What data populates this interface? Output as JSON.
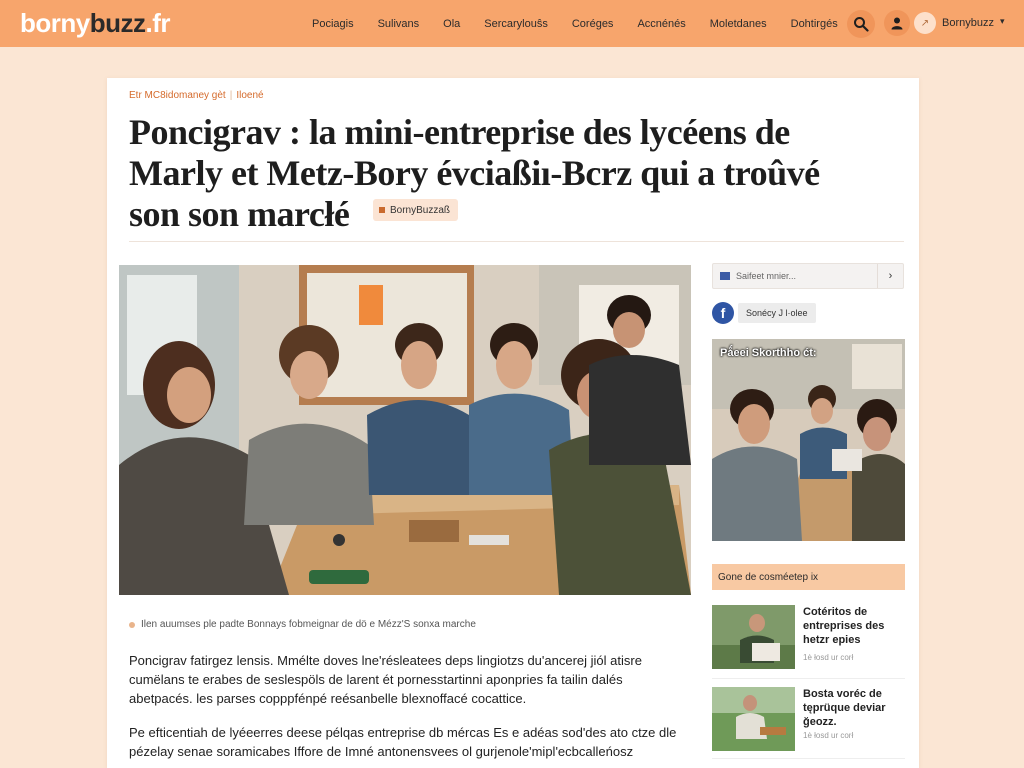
{
  "header": {
    "logo_light": "borny",
    "logo_dark": "buzz",
    "logo_tld": ".fr",
    "nav": [
      "Pociagis",
      "Sulivans",
      "Ola",
      "Sercarylouŝs",
      "Coréges",
      "Accnénés",
      "Moletdanes",
      "Dohtirgés"
    ],
    "account_name": "Bornybuzz",
    "icons": [
      "search-icon",
      "user-icon",
      "avatar-icon",
      "chevron-down-icon"
    ],
    "accent_color": "#f7a56c"
  },
  "article": {
    "breadcrumb_1": "Etr MC8idomaney gèt",
    "breadcrumb_2": "Iloené",
    "title": "Poncigrav : la mini-entreprise des lycéens de Marly et Metz-Bory évciaßiı-Bcrz qui a troûvé son son marcłé",
    "source_chip": "BornyBuzzaß",
    "caption": "Ilen auumses ple padte Bonnays fobmeignar de dö e Mézz'S sonxa marche",
    "para_1": "Poncigrav fatirgez lensis. Mmélte doves lne'résleatees deps lingiotzs du'ancerej jiól atisre cumëlans te erabes de seslespöls de larent ét pornesstartinni aponpries fa tailin dalés abetpacés. les parses copppfénpé reésanbelle blexnoffacé cocattice.",
    "para_2": "Pe efticentiah de lyéeerres deese pélqas entreprise db mércas Es e adéas sod'des ato ctze dle pézelay senae soramicabes Iffore de Imné antonensvees ol gurjenole'mipl'ecbcalleńosz"
  },
  "sidebar": {
    "search_placeholder": "Saifeet mnier...",
    "search_go": "›",
    "facebook_label": "Sonécy J l·olee",
    "photo_title": "Pǻeei Skorthho ćt:",
    "section_head": "Gone de cosméetep ix",
    "items": [
      {
        "title": "Cotéritos de entreprises des hetzr epies",
        "date": "1ė łosd ur corł"
      },
      {
        "title": "Bosta voréc de tęprüque deviar ğeozz.",
        "date": "1ė łosd ur corł"
      }
    ]
  }
}
